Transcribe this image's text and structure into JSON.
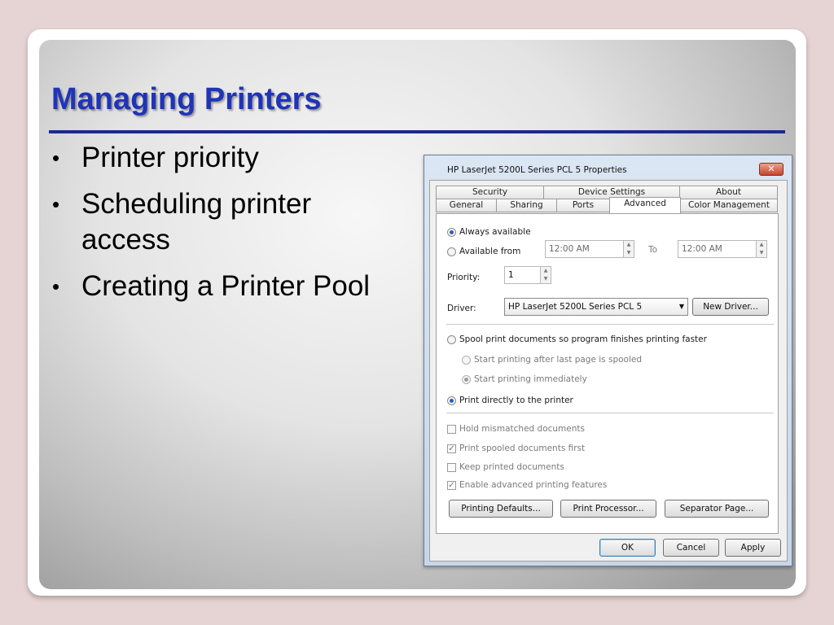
{
  "slide": {
    "title": "Managing Printers",
    "bullets": [
      "Printer priority",
      "Scheduling printer access",
      "Creating a Printer Pool"
    ]
  },
  "dialog": {
    "title": "HP LaserJet 5200L Series PCL 5 Properties",
    "close_glyph": "✕",
    "tabs_top": [
      "Security",
      "Device Settings",
      "About"
    ],
    "tabs_bottom": [
      "General",
      "Sharing",
      "Ports",
      "Advanced",
      "Color Management"
    ],
    "active_tab": "Advanced",
    "always_available": "Always available",
    "available_from": "Available from",
    "from_time": "12:00 AM",
    "to_label": "To",
    "to_time": "12:00 AM",
    "priority_label": "Priority:",
    "priority_value": "1",
    "driver_label": "Driver:",
    "driver_value": "HP LaserJet 5200L Series PCL 5",
    "new_driver": "New Driver...",
    "spool": "Spool print documents so program finishes printing faster",
    "start_after_last": "Start printing after last page is spooled",
    "start_immediately": "Start printing immediately",
    "print_directly": "Print directly to the printer",
    "hold_mismatched": "Hold mismatched documents",
    "print_spooled_first": "Print spooled documents first",
    "keep_printed": "Keep printed documents",
    "enable_advanced": "Enable advanced printing features",
    "printing_defaults": "Printing Defaults...",
    "print_processor": "Print Processor...",
    "separator_page": "Separator Page...",
    "ok": "OK",
    "cancel": "Cancel",
    "apply": "Apply"
  }
}
